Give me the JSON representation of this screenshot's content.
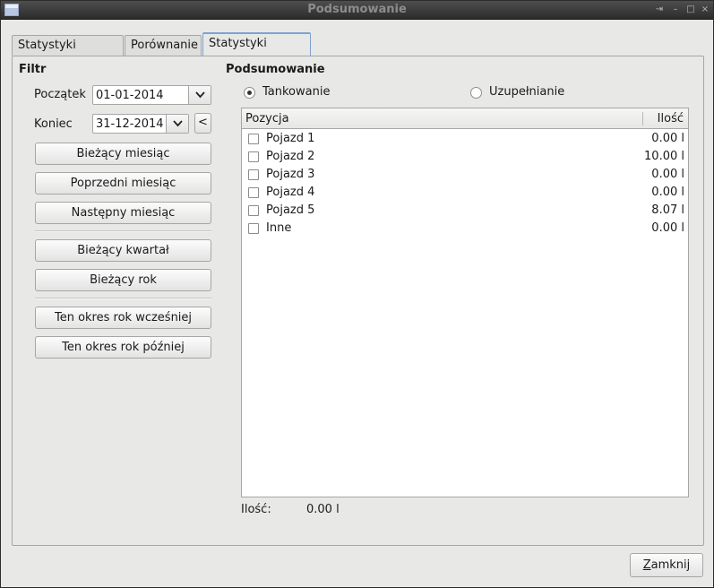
{
  "window": {
    "title": "Podsumowanie"
  },
  "tabs": [
    {
      "label": "Statystyki pozycji"
    },
    {
      "label": "Porównanie"
    },
    {
      "label": "Statystyki paliwa",
      "active": true
    }
  ],
  "filter": {
    "title": "Filtr",
    "start_label": "Początek",
    "start_value": "01-01-2014",
    "end_label": "Koniec",
    "end_value": "31-12-2014",
    "copy_button": "<",
    "buttons": [
      "Bieżący miesiąc",
      "Poprzedni miesiąc",
      "Następny miesiąc",
      "Bieżący kwartał",
      "Bieżący rok",
      "Ten okres rok wcześniej",
      "Ten okres rok później"
    ]
  },
  "summary": {
    "title": "Podsumowanie",
    "radio_fueling": "Tankowanie",
    "radio_refill": "Uzupełnianie",
    "selected_radio": "Tankowanie",
    "columns": [
      "Pozycja",
      "Ilość"
    ],
    "rows": [
      {
        "name": "Pojazd 1",
        "qty": "0.00 l"
      },
      {
        "name": "Pojazd 2",
        "qty": "10.00 l"
      },
      {
        "name": "Pojazd 3",
        "qty": "0.00 l"
      },
      {
        "name": "Pojazd 4",
        "qty": "0.00 l"
      },
      {
        "name": "Pojazd 5",
        "qty": "8.07 l"
      },
      {
        "name": "Inne",
        "qty": "0.00 l"
      }
    ],
    "total_label": "Ilość:",
    "total_value": "0.00 l"
  },
  "footer": {
    "close_prefix": "",
    "close_mnemonic": "Z",
    "close_rest": "amknij"
  },
  "colors": {
    "tab_accent": "#7ea2d3",
    "titlebar": "#2c2c2c"
  }
}
